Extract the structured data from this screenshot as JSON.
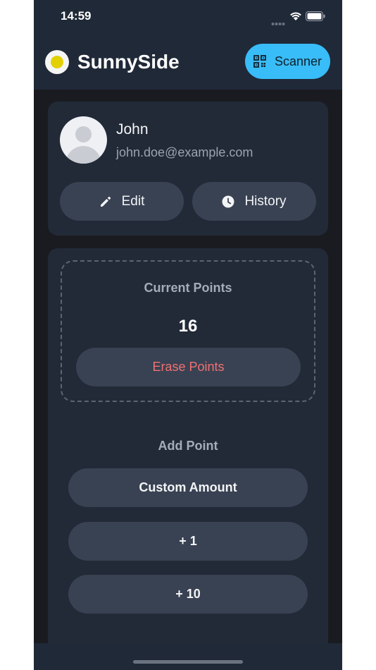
{
  "status_bar": {
    "time": "14:59"
  },
  "header": {
    "app_name": "SunnySide",
    "scanner_label": "Scanner"
  },
  "profile": {
    "name": "John",
    "email": "john.doe@example.com",
    "edit_label": "Edit",
    "history_label": "History"
  },
  "points": {
    "label": "Current Points",
    "value": "16",
    "erase_label": "Erase Points"
  },
  "add_point": {
    "label": "Add Point",
    "custom_label": "Custom Amount",
    "plus_one_label": "+ 1",
    "plus_ten_label": "+ 10"
  },
  "colors": {
    "accent": "#38bdf8",
    "danger_text": "#f07171",
    "sun": "#e3d000"
  },
  "icons": [
    "wifi-icon",
    "battery-icon",
    "signal-icon",
    "qr-code-icon",
    "pencil-icon",
    "clock-icon",
    "avatar-placeholder-icon"
  ]
}
